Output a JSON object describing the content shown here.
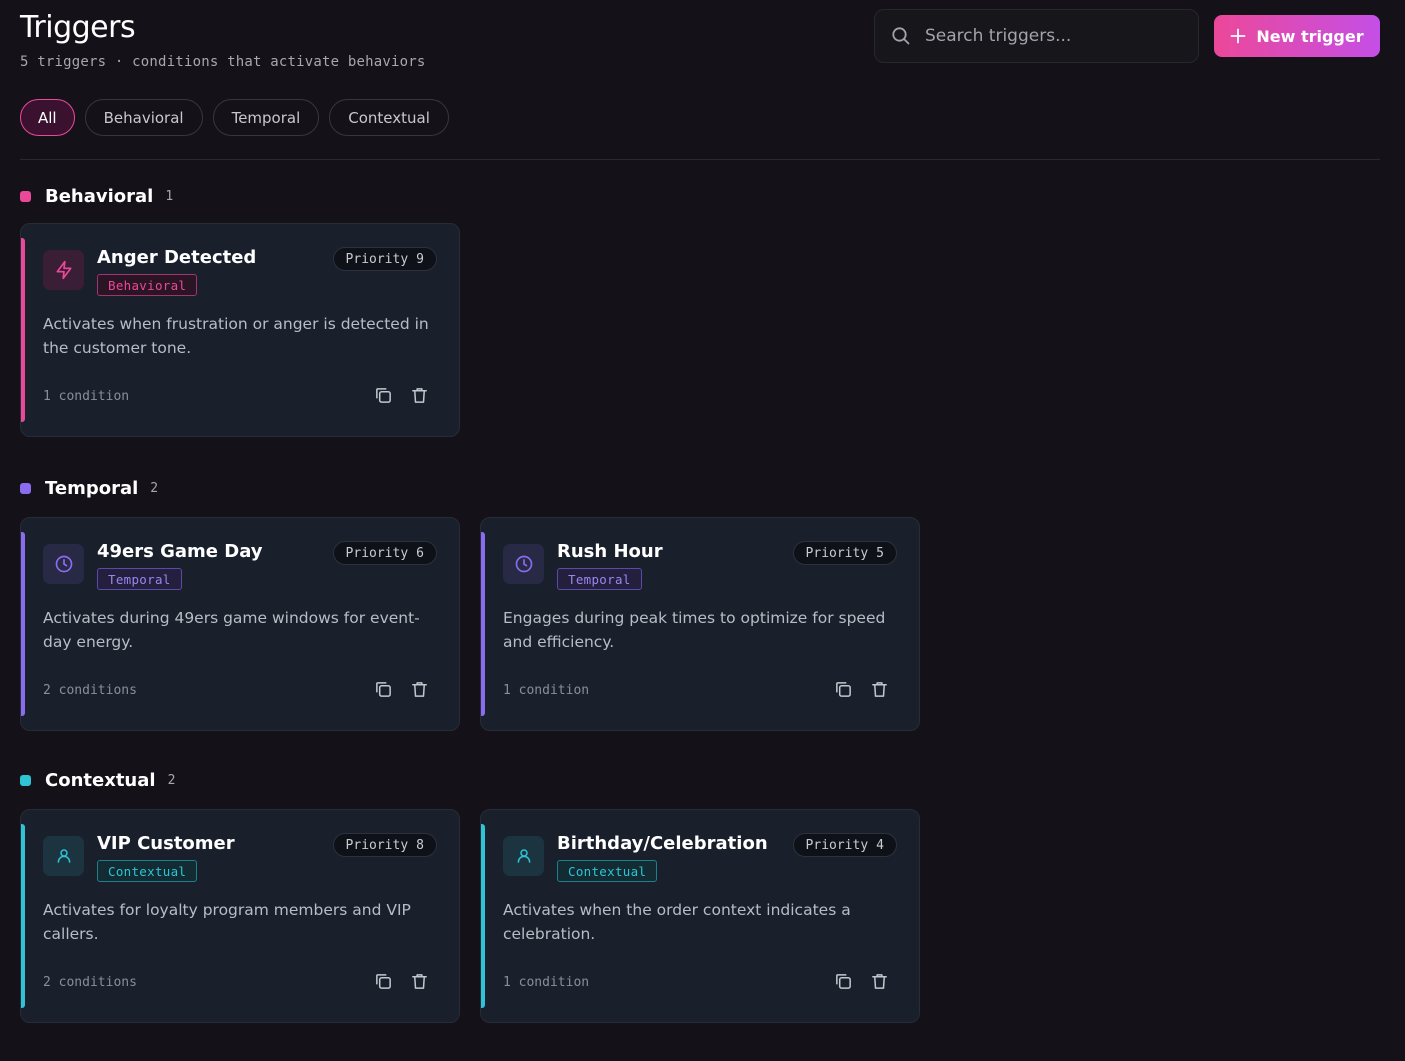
{
  "header": {
    "title": "Triggers",
    "subtitle": "5 triggers · conditions that activate behaviors"
  },
  "search": {
    "placeholder": "Search triggers..."
  },
  "new_button": {
    "label": "New trigger",
    "icon": "plus-icon"
  },
  "filters": [
    {
      "label": "All",
      "active": true
    },
    {
      "label": "Behavioral",
      "active": false
    },
    {
      "label": "Temporal",
      "active": false
    },
    {
      "label": "Contextual",
      "active": false
    }
  ],
  "colors": {
    "behavioral": "#ec4899",
    "temporal": "#8b6cf0",
    "contextual": "#2ec4d6",
    "accent_gradient_start": "#ec4899",
    "accent_gradient_end": "#c44fe6"
  },
  "sections": [
    {
      "title": "Behavioral",
      "count": "1",
      "cards": [
        {
          "title": "Anger Detected",
          "tag": "Behavioral",
          "icon": "lightning-icon",
          "priority_label": "Priority",
          "priority_value": "9",
          "description": "Activates when frustration or anger is detected in the customer tone.",
          "conditions": "1 condition"
        }
      ]
    },
    {
      "title": "Temporal",
      "count": "2",
      "cards": [
        {
          "title": "49ers Game Day",
          "tag": "Temporal",
          "icon": "clock-icon",
          "priority_label": "Priority",
          "priority_value": "6",
          "description": "Activates during 49ers game windows for event-day energy.",
          "conditions": "2 conditions"
        },
        {
          "title": "Rush Hour",
          "tag": "Temporal",
          "icon": "clock-icon",
          "priority_label": "Priority",
          "priority_value": "5",
          "description": "Engages during peak times to optimize for speed and efficiency.",
          "conditions": "1 condition"
        }
      ]
    },
    {
      "title": "Contextual",
      "count": "2",
      "cards": [
        {
          "title": "VIP Customer",
          "tag": "Contextual",
          "icon": "user-icon",
          "priority_label": "Priority",
          "priority_value": "8",
          "description": "Activates for loyalty program members and VIP callers.",
          "conditions": "2 conditions"
        },
        {
          "title": "Birthday/Celebration",
          "tag": "Contextual",
          "icon": "user-icon",
          "priority_label": "Priority",
          "priority_value": "4",
          "description": "Activates when the order context indicates a celebration.",
          "conditions": "1 condition"
        }
      ]
    }
  ]
}
